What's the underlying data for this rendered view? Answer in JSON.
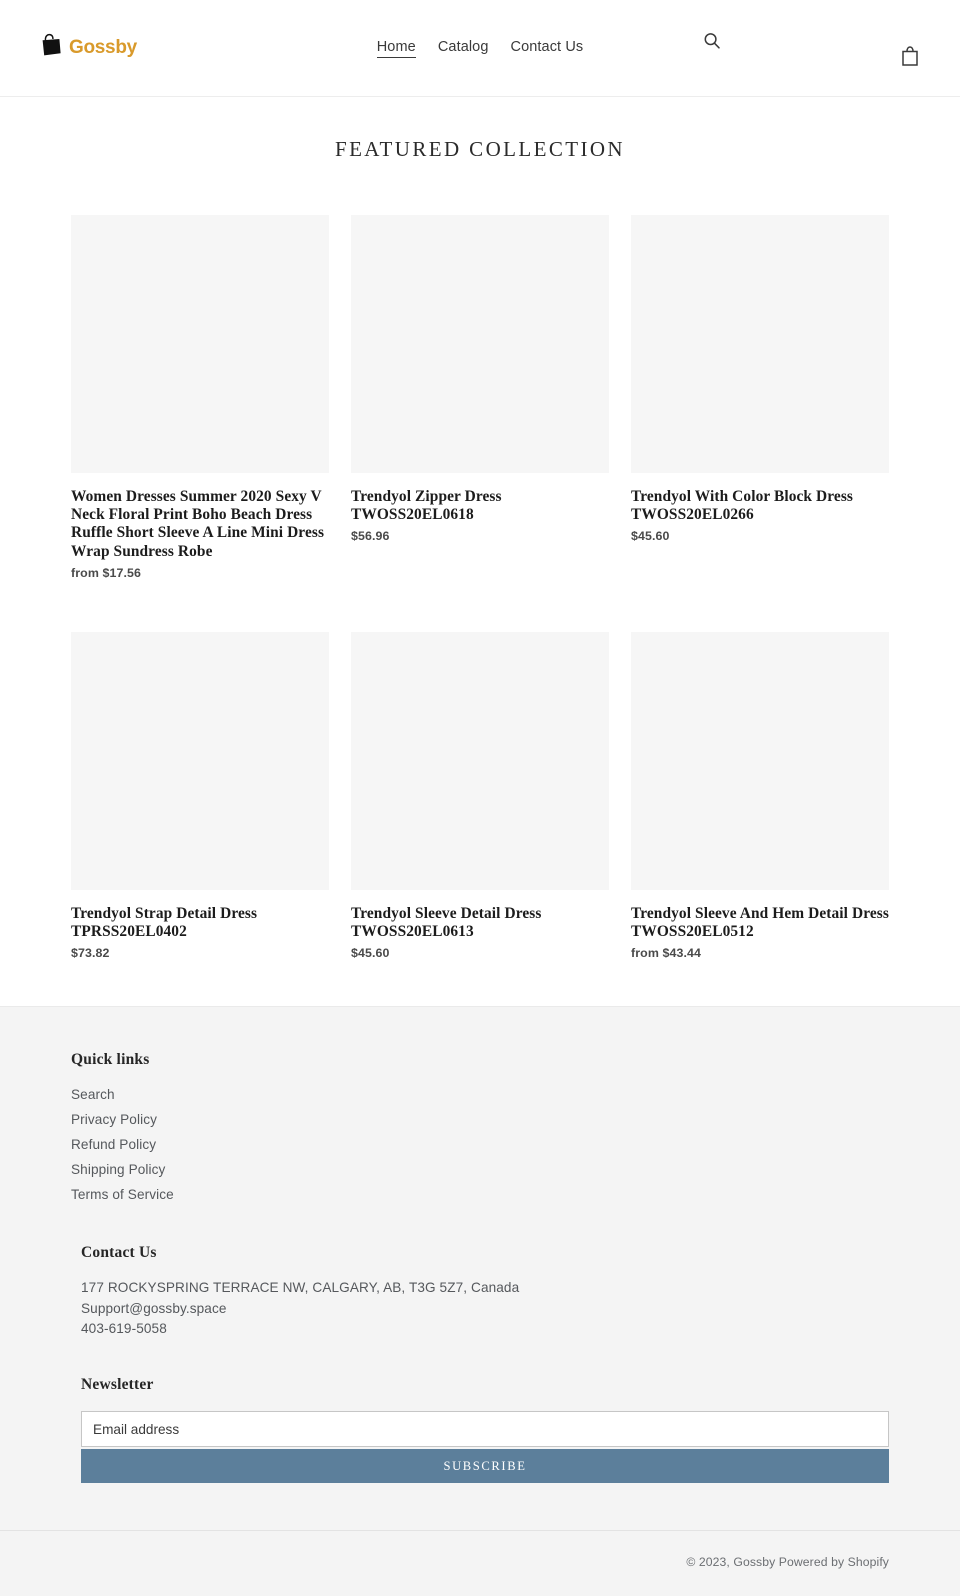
{
  "header": {
    "logo": {
      "icon": "shopping-bag-icon",
      "text": "Gossby",
      "color": "#d99a2b"
    },
    "nav": [
      {
        "label": "Home",
        "active": true
      },
      {
        "label": "Catalog",
        "active": false
      },
      {
        "label": "Contact Us",
        "active": false
      }
    ],
    "search_icon": "search-icon",
    "cart_icon": "cart-icon"
  },
  "main": {
    "section_title": "FEATURED COLLECTION",
    "products": [
      {
        "title": "Women Dresses Summer 2020 Sexy V Neck Floral Print Boho Beach Dress Ruffle Short Sleeve A Line Mini Dress Wrap Sundress Robe",
        "price": "from $17.56"
      },
      {
        "title": "Trendyol Zipper Dress TWOSS20EL0618",
        "price": "$56.96"
      },
      {
        "title": "Trendyol With Color Block Dress TWOSS20EL0266",
        "price": "$45.60"
      },
      {
        "title": "Trendyol Strap Detail Dress TPRSS20EL0402",
        "price": "$73.82"
      },
      {
        "title": "Trendyol Sleeve Detail Dress TWOSS20EL0613",
        "price": "$45.60"
      },
      {
        "title": "Trendyol Sleeve And Hem Detail Dress TWOSS20EL0512",
        "price": "from $43.44"
      }
    ]
  },
  "footer": {
    "quick_links_heading": "Quick links",
    "quick_links": [
      "Search",
      "Privacy Policy",
      "Refund Policy",
      "Shipping Policy",
      "Terms of Service"
    ],
    "contact_heading": "Contact Us",
    "contact_address": "177 ROCKYSPRING TERRACE NW, CALGARY, AB, T3G 5Z7, Canada",
    "contact_email": "Support@gossby.space",
    "contact_phone": "403-619-5058",
    "newsletter_heading": "Newsletter",
    "email_placeholder": "Email address",
    "email_value": "",
    "subscribe_label": "SUBSCRIBE",
    "subscribe_color": "#5c7f9b",
    "copyright": "© 2023, Gossby",
    "powered_by": "Powered by Shopify"
  }
}
